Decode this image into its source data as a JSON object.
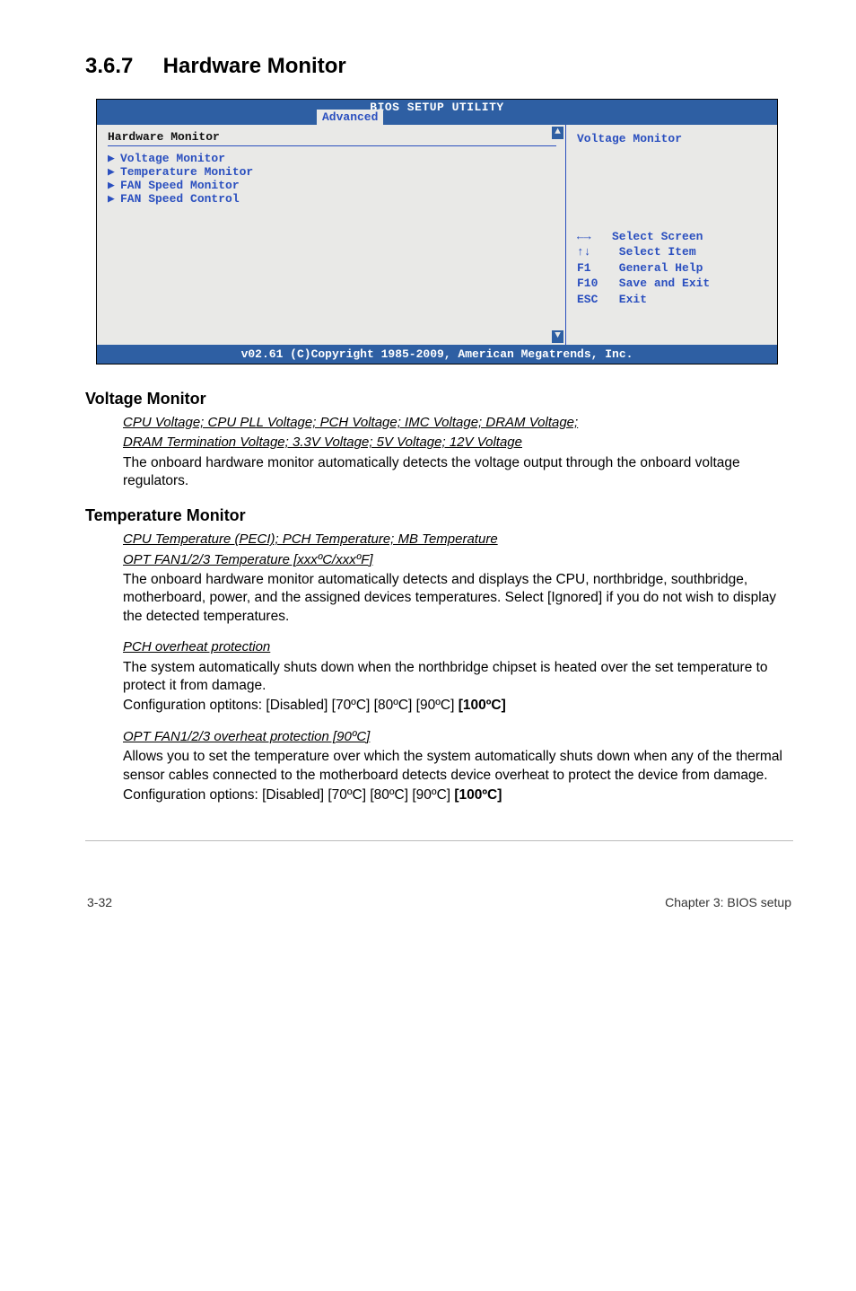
{
  "section": {
    "number": "3.6.7",
    "title": "Hardware Monitor"
  },
  "bios": {
    "title": "BIOS SETUP UTILITY",
    "tab": "Advanced",
    "left_heading": "Hardware Monitor",
    "menu": [
      "Voltage Monitor",
      "Temperature Monitor",
      "FAN Speed Monitor",
      "FAN Speed Control"
    ],
    "right_context": "Voltage Monitor",
    "keys": {
      "lr": "←→   Select Screen",
      "ud": "↑↓    Select Item",
      "f1": "F1    General Help",
      "f10": "F10   Save and Exit",
      "esc": "ESC   Exit"
    },
    "footer": "v02.61 (C)Copyright 1985-2009, American Megatrends, Inc."
  },
  "voltage_monitor": {
    "heading": "Voltage Monitor",
    "item_title_1": "CPU Voltage; CPU PLL Voltage; PCH Voltage; IMC Voltage; DRAM Voltage;",
    "item_title_2": "DRAM Termination Voltage; 3.3V Voltage; 5V Voltage; 12V Voltage",
    "body": "The onboard hardware monitor automatically detects the voltage output through the onboard voltage regulators."
  },
  "temperature_monitor": {
    "heading": "Temperature Monitor",
    "item1_title_1": "CPU Temperature (PECI); PCH Temperature; MB Temperature",
    "item1_title_2": "OPT FAN1/2/3 Temperature [xxxºC/xxxºF]",
    "item1_body": "The onboard hardware monitor automatically detects and displays the CPU, northbridge, southbridge, motherboard, power, and the assigned devices temperatures. Select [Ignored] if you do not wish to display the detected temperatures.",
    "item2_title": "PCH overheat protection",
    "item2_body_1": "The system automatically shuts down when the northbridge chipset is heated over the set temperature to protect it from damage.",
    "item2_body_2a": "Configuration optitons: [Disabled] [70ºC] [80ºC] [90ºC] ",
    "item2_body_2b": "[100ºC]",
    "item3_title": "OPT FAN1/2/3 overheat protection [90ºC]",
    "item3_body_1": "Allows you to set the temperature over which the system automatically shuts down when any of the thermal sensor cables connected to the motherboard detects device overheat to protect the device from damage.",
    "item3_body_2a": "Configuration options: [Disabled] [70ºC] [80ºC] [90ºC] ",
    "item3_body_2b": "[100ºC]"
  },
  "footer": {
    "left": "3-32",
    "right": "Chapter 3: BIOS setup"
  }
}
